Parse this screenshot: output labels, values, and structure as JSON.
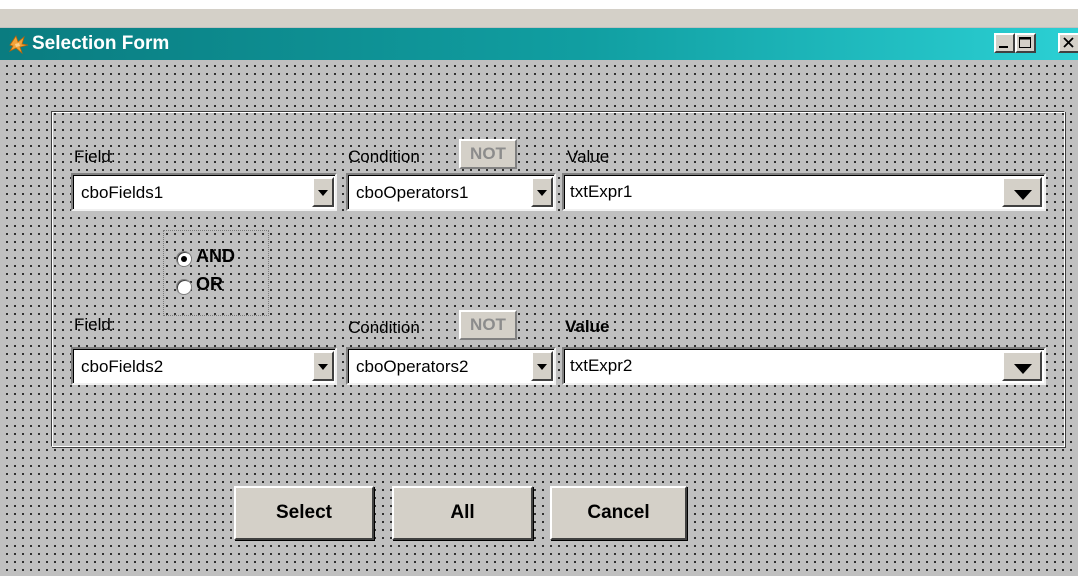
{
  "window": {
    "title": "Selection Form"
  },
  "row1": {
    "field_label": "Field:",
    "condition_label": "Condition",
    "not_label": "NOT",
    "value_label": "Value",
    "field_combo": "cboFields1",
    "operator_combo": "cboOperators1",
    "value_input": "txtExpr1"
  },
  "logic": {
    "options": [
      "AND",
      "OR"
    ],
    "selected": "AND"
  },
  "row2": {
    "field_label": "Field:",
    "condition_label": "Condition",
    "not_label": "NOT",
    "value_label": "Value",
    "field_combo": "cboFields2",
    "operator_combo": "cboOperators2",
    "value_input": "txtExpr2"
  },
  "buttons": {
    "select": "Select",
    "all": "All",
    "cancel": "Cancel"
  },
  "icons": {
    "app": "fox-icon",
    "minimize": "minimize-icon",
    "maximize": "maximize-icon",
    "close": "close-icon"
  },
  "colors": {
    "titlebar_start": "#0a7c80",
    "titlebar_end": "#2bd0d4",
    "face": "#c0c0c0"
  }
}
